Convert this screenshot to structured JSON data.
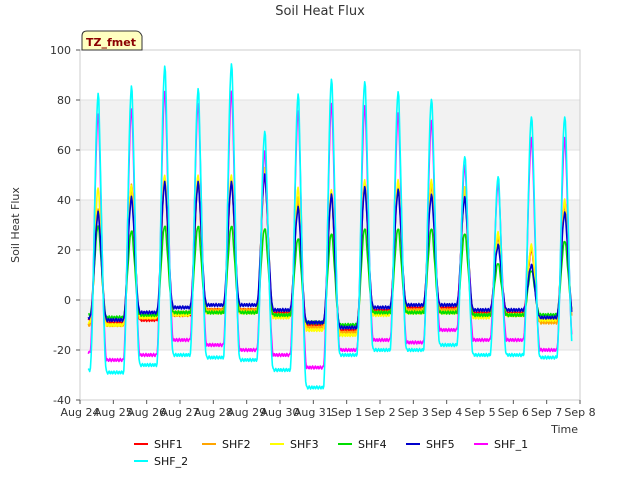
{
  "chart_data": {
    "type": "line",
    "title": "Soil Heat Flux",
    "xlabel": "Time",
    "ylabel": "Soil Heat Flux",
    "annotation": "TZ_fmet",
    "ylim": [
      -40,
      100
    ],
    "yticks": [
      -40,
      -20,
      0,
      20,
      40,
      60,
      80,
      100
    ],
    "xlim": [
      "2018-08-24",
      "2018-09-08"
    ],
    "xticks": [
      "Aug 24",
      "Aug 25",
      "Aug 26",
      "Aug 27",
      "Aug 28",
      "Aug 29",
      "Aug 30",
      "Aug 31",
      "Sep 1",
      "Sep 2",
      "Sep 3",
      "Sep 4",
      "Sep 5",
      "Sep 6",
      "Sep 7",
      "Sep 8"
    ],
    "grid": "horizontal bands",
    "legend_position": "bottom",
    "x_start": "2018-08-24 06:00",
    "x_end": "2018-09-07 18:00",
    "samples_per_day": 48,
    "days": [
      "Aug 24",
      "Aug 25",
      "Aug 26",
      "Aug 27",
      "Aug 28",
      "Aug 29",
      "Aug 30",
      "Aug 31",
      "Sep 1",
      "Sep 2",
      "Sep 3",
      "Sep 4",
      "Sep 5",
      "Sep 6",
      "Sep 7"
    ],
    "series": [
      {
        "name": "SHF1",
        "color": "#ff0000",
        "daily_peak": [
          35,
          45,
          47,
          47,
          47,
          50,
          40,
          42,
          46,
          46,
          46,
          42,
          25,
          20,
          38
        ],
        "daily_min": [
          -8,
          -9,
          -8,
          -6,
          -4,
          -4,
          -5,
          -10,
          -12,
          -4,
          -3,
          -3,
          -5,
          -5,
          -8
        ]
      },
      {
        "name": "SHF2",
        "color": "#ffa500",
        "daily_peak": [
          36,
          46,
          48,
          48,
          48,
          51,
          41,
          43,
          47,
          47,
          47,
          43,
          26,
          21,
          39
        ],
        "daily_min": [
          -10,
          -10,
          -7,
          -5,
          -4,
          -4,
          -6,
          -11,
          -13,
          -5,
          -4,
          -4,
          -6,
          -6,
          -9
        ]
      },
      {
        "name": "SHF3",
        "color": "#ffff00",
        "daily_peak": [
          45,
          46,
          50,
          50,
          50,
          53,
          45,
          44,
          48,
          48,
          48,
          45,
          27,
          22,
          40
        ],
        "daily_min": [
          -9,
          -10,
          -7,
          -6,
          -5,
          -5,
          -7,
          -12,
          -14,
          -6,
          -5,
          -5,
          -7,
          -6,
          -8
        ]
      },
      {
        "name": "SHF4",
        "color": "#00dd00",
        "daily_peak": [
          30,
          28,
          30,
          30,
          30,
          29,
          25,
          27,
          29,
          29,
          29,
          27,
          15,
          12,
          24
        ],
        "daily_min": [
          -6,
          -7,
          -6,
          -5,
          -5,
          -5,
          -6,
          -9,
          -10,
          -5,
          -5,
          -5,
          -6,
          -6,
          -6
        ]
      },
      {
        "name": "SHF5",
        "color": "#0000cc",
        "daily_peak": [
          35,
          41,
          47,
          47,
          47,
          50,
          37,
          42,
          45,
          44,
          42,
          41,
          22,
          14,
          35
        ],
        "daily_min": [
          -7,
          -8,
          -5,
          -3,
          -2,
          -2,
          -4,
          -9,
          -11,
          -3,
          -2,
          -2,
          -4,
          -4,
          -7
        ]
      },
      {
        "name": "SHF_1",
        "color": "#ff00ff",
        "daily_peak": [
          75,
          77,
          84,
          79,
          84,
          60,
          76,
          79,
          78,
          75,
          72,
          54,
          47,
          65,
          65
        ],
        "daily_min": [
          -21,
          -24,
          -22,
          -16,
          -18,
          -20,
          -22,
          -27,
          -20,
          -16,
          -17,
          -12,
          -16,
          -16,
          -20
        ]
      },
      {
        "name": "SHF_2",
        "color": "#00ffff",
        "daily_peak": [
          83,
          86,
          94,
          85,
          95,
          68,
          83,
          89,
          88,
          84,
          81,
          58,
          50,
          74,
          74
        ],
        "daily_min": [
          -28,
          -29,
          -26,
          -22,
          -23,
          -24,
          -28,
          -35,
          -22,
          -20,
          -20,
          -18,
          -22,
          -22,
          -23
        ]
      }
    ]
  }
}
